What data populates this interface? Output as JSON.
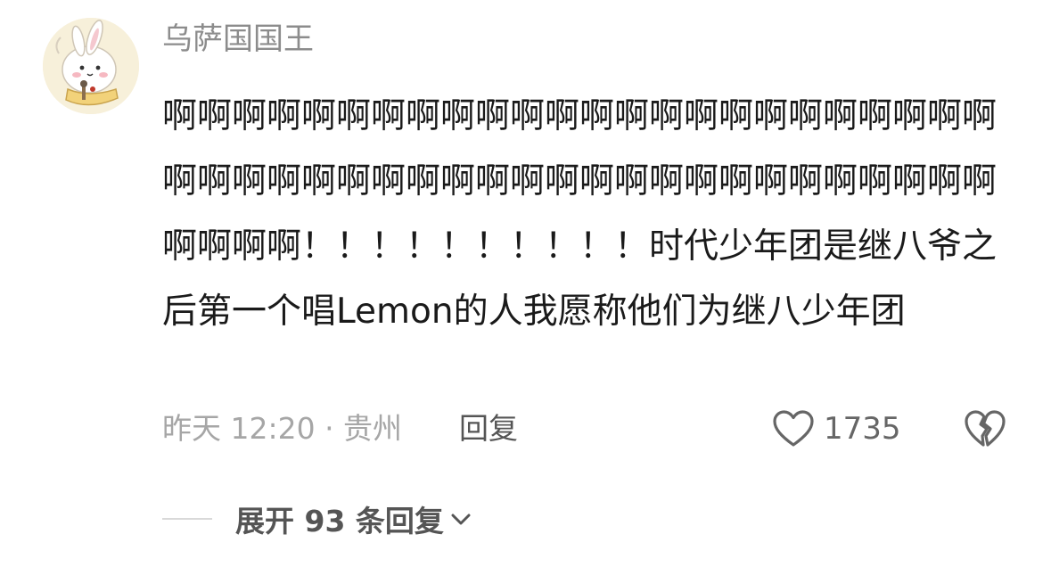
{
  "comment": {
    "username": "乌萨国国王",
    "text": "啊啊啊啊啊啊啊啊啊啊啊啊啊啊啊啊啊啊啊啊啊啊啊啊啊啊啊啊啊啊啊啊啊啊啊啊啊啊啊啊啊啊啊啊啊啊啊啊啊啊啊啊！！！！！！！！！！时代少年团是继八爷之后第一个唱Lemon的人我愿称他们为继八少年团",
    "meta": "昨天 12:20 · 贵州",
    "reply_label": "回复",
    "like_count": "1735",
    "expand_label": "展开 93 条回复"
  },
  "icons": {
    "like": "heart-outline-icon",
    "dislike": "broken-heart-icon",
    "expand": "chevron-down-icon"
  },
  "colors": {
    "username": "#8c8c8c",
    "text": "#1a1a1a",
    "meta": "#a6a6a6",
    "action": "#555555"
  }
}
